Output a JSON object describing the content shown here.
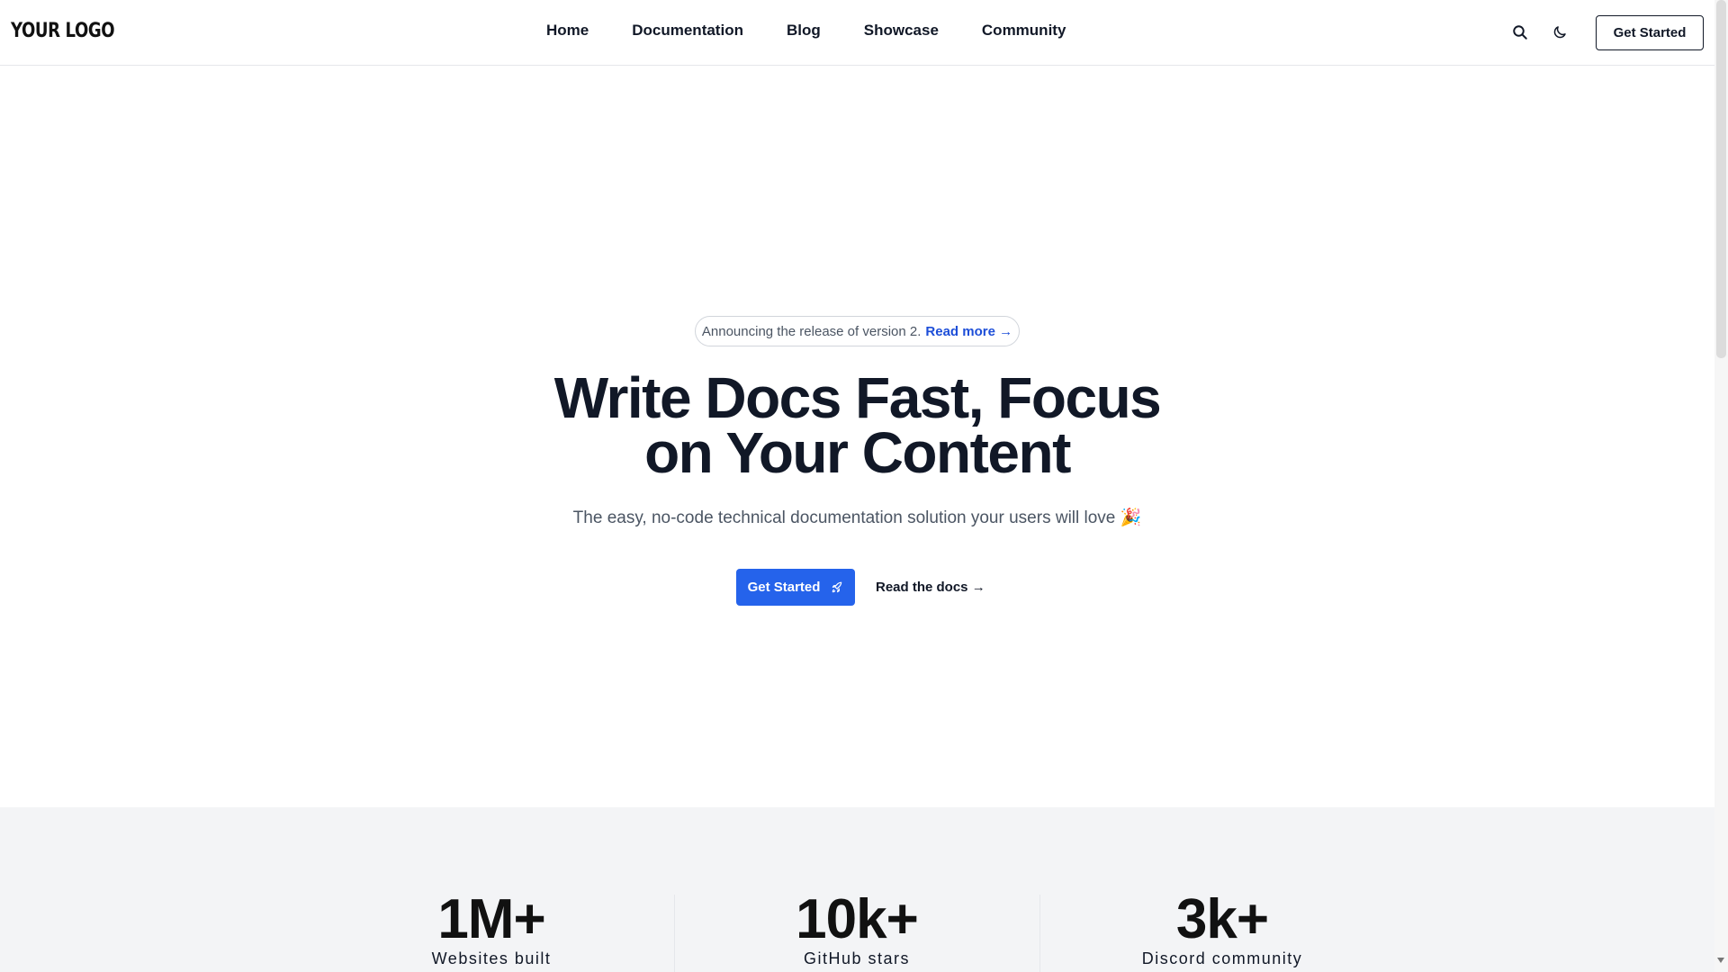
{
  "header": {
    "logo_text": "YOUR LOGO",
    "nav": [
      {
        "label": "Home"
      },
      {
        "label": "Documentation"
      },
      {
        "label": "Blog"
      },
      {
        "label": "Showcase"
      },
      {
        "label": "Community"
      }
    ],
    "icons": {
      "search": "search-icon",
      "theme": "moon-icon"
    },
    "cta_label": "Get Started"
  },
  "hero": {
    "announcement_text": "Announcing the release of version 2.",
    "announcement_link": "Read more →",
    "title_line1": "Write Docs Fast, Focus",
    "title_line2": "on Your Content",
    "subtitle": "The easy, no-code technical documentation solution your users will love 🎉",
    "primary_button": "Get Started",
    "primary_button_icon": "rocket-icon",
    "secondary_button": "Read the docs →"
  },
  "stats": [
    {
      "value": "1M+",
      "label": "Websites built"
    },
    {
      "value": "10k+",
      "label": "GitHub stars"
    },
    {
      "value": "3k+",
      "label": "Discord community"
    }
  ],
  "colors": {
    "accent": "#2563eb",
    "link": "#1d4ed8",
    "text": "#111827",
    "muted": "#4b5563",
    "stats_background": "#f3f4f6"
  }
}
